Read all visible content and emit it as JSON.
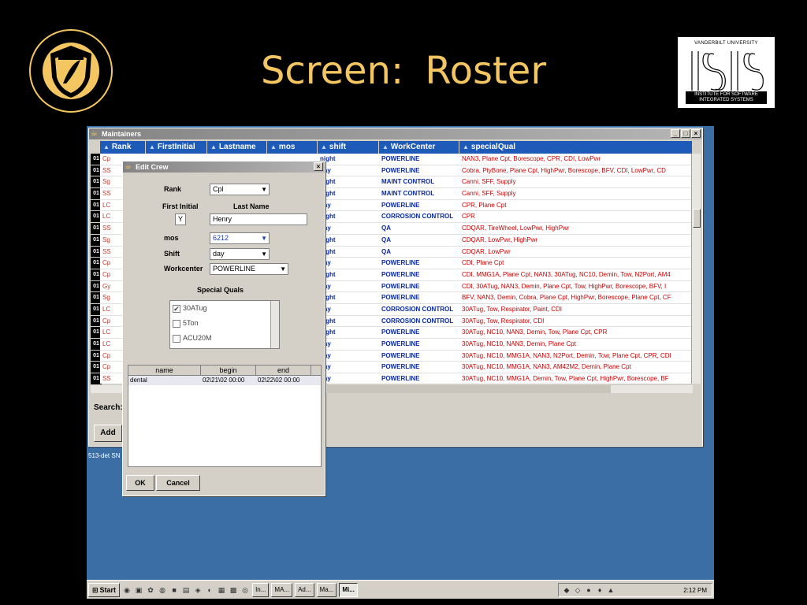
{
  "slide": {
    "title": "Screen:  Roster",
    "seal_text": "VANDERBILT UNIVERSITY",
    "isis_top": "VANDERBILT UNIVERSITY",
    "isis_bottom_1": "INSTITUTE FOR SOFTWARE",
    "isis_bottom_2": "INTEGRATED SYSTEMS",
    "colors": {
      "title": "#f3c662",
      "background": "#000000"
    }
  },
  "main_window": {
    "title": "Maintainers",
    "columns": [
      "Rank",
      "FirstInitial",
      "Lastname",
      "mos",
      "shift",
      "WorkCenter",
      "specialQual"
    ],
    "row_header": "01",
    "rows": [
      [
        "Cp",
        "",
        "",
        "",
        "night",
        "POWERLINE",
        "NAN3, Plane Cpt, Borescope, CPR, CDI, LowPwr"
      ],
      [
        "SS",
        "",
        "",
        "",
        "day",
        "POWERLINE",
        "Cobra, PtyBone, Plane Cpt, HighPwr, Borescope, BFV, CDI, LowPwr, CD"
      ],
      [
        "Sg",
        "",
        "",
        "",
        "night",
        "MAINT CONTROL",
        "Canni, SFF, Supply"
      ],
      [
        "SS",
        "",
        "",
        "",
        "night",
        "MAINT CONTROL",
        "Canni, SFF, Supply"
      ],
      [
        "LC",
        "",
        "",
        "",
        "day",
        "POWERLINE",
        "CPR, Plane Cpt"
      ],
      [
        "LC",
        "",
        "",
        "",
        "night",
        "CORROSION CONTROL",
        "CPR"
      ],
      [
        "SS",
        "",
        "",
        "",
        "day",
        "QA",
        "CDQAR, TireWheel, LowPwr, HighPwr"
      ],
      [
        "Sg",
        "",
        "",
        "",
        "night",
        "QA",
        "CDQAR, LowPwr, HighPwr"
      ],
      [
        "SS",
        "",
        "",
        "",
        "night",
        "QA",
        "CDQAR, LowPwr"
      ],
      [
        "Cp",
        "",
        "",
        "",
        "day",
        "POWERLINE",
        "CDI, Plane Cpt"
      ],
      [
        "Cp",
        "",
        "",
        "",
        "night",
        "POWERLINE",
        "CDI, MMG1A, Plane Cpt, NAN3, 30ATug, NC10, Demin, Tow, N2Port, AM4"
      ],
      [
        "Gy",
        "",
        "",
        "",
        "day",
        "POWERLINE",
        "CDI, 30ATug, NAN3, Demin, Plane Cpt, Tow, HighPwr, Borescope, BFV, I"
      ],
      [
        "Sg",
        "",
        "",
        "",
        "night",
        "POWERLINE",
        "BFV, NAN3, Demin, Cobra, Plane Cpt, HighPwr, Borescope, Plane Cpt, CF"
      ],
      [
        "LC",
        "",
        "",
        "",
        "day",
        "CORROSION CONTROL",
        "30ATug, Tow, Respirator, Paint, CDI"
      ],
      [
        "Cp",
        "",
        "",
        "",
        "night",
        "CORROSION CONTROL",
        "30ATug, Tow, Respirator, CDI"
      ],
      [
        "LC",
        "",
        "",
        "",
        "night",
        "POWERLINE",
        "30ATug, NC10, NAN3, Demin, Tow, Plane Cpt, CPR"
      ],
      [
        "LC",
        "",
        "",
        "",
        "day",
        "POWERLINE",
        "30ATug, NC10, NAN3, Demin, Plane Cpt"
      ],
      [
        "Cp",
        "",
        "",
        "",
        "day",
        "POWERLINE",
        "30ATug, NC10, MMG1A, NAN3, N2Port, Demin, Tow, Plane Cpt, CPR, CDI"
      ],
      [
        "Cp",
        "",
        "",
        "",
        "day",
        "POWERLINE",
        "30ATug, NC10, MMG1A, NAN3, AM42M2, Demin, Plane Cpt"
      ],
      [
        "SS",
        "",
        "",
        "",
        "day",
        "POWERLINE",
        "30ATug, NC10, MMG1A, Demin, Tow, Plane Cpt, HighPwr, Borescope, BF"
      ]
    ],
    "search_label": "Search:",
    "add_label": "Add",
    "status_text": "513-det SN"
  },
  "dialog": {
    "title": "Edit Crew",
    "rank_label": "Rank",
    "rank_value": "Cpl",
    "first_initial_label": "First Initial",
    "last_name_label": "Last Name",
    "first_initial_value": "Y",
    "last_name_value": "Henry",
    "mos_label": "mos",
    "mos_value": "6212",
    "shift_label": "Shift",
    "shift_value": "day",
    "workcenter_label": "Workcenter",
    "workcenter_value": "POWERLINE",
    "quals_label": "Special Quals",
    "quals": [
      {
        "name": "30ATug",
        "checked": true
      },
      {
        "name": "5Ton",
        "checked": false
      },
      {
        "name": "ACU20M",
        "checked": false
      }
    ],
    "table_columns": [
      "name",
      "begin",
      "end"
    ],
    "table_rows": [
      [
        "dental",
        "02\\21\\02 00:00",
        "02\\22\\02 00:00"
      ]
    ],
    "ok_label": "OK",
    "cancel_label": "Cancel"
  },
  "taskbar": {
    "start_label": "Start",
    "tasks": [
      "In...",
      "MA...",
      "Ad...",
      "Ma...",
      "Mi..."
    ],
    "active_task": "Mi...",
    "clock": "2:12 PM"
  }
}
